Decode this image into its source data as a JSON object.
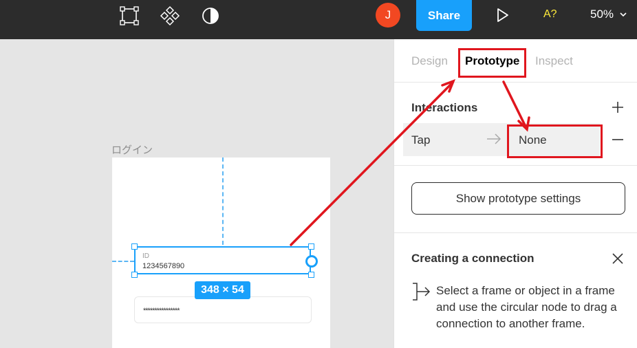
{
  "toolbar": {
    "icons": [
      "frame-tool-icon",
      "component-icon",
      "contrast-icon"
    ],
    "avatar_initial": "J",
    "share_label": "Share",
    "play_icon": "play-icon",
    "accessibility_label": "A?",
    "zoom_label": "50%"
  },
  "canvas": {
    "frame_label": "ログイン",
    "id_field": {
      "label": "ID",
      "value": "1234567890"
    },
    "size_badge": "348 × 54",
    "password_field": {
      "value": "****************"
    }
  },
  "panel": {
    "tabs": [
      "Design",
      "Prototype",
      "Inspect"
    ],
    "active_tab": "Prototype",
    "interactions": {
      "title": "Interactions",
      "trigger": "Tap",
      "action": "None"
    },
    "settings_button": "Show prototype settings",
    "connection": {
      "title": "Creating a connection",
      "help": "Select a frame or object in a frame and use the circular node to drag a connection to another frame."
    }
  },
  "colors": {
    "toolbar_bg": "#2c2c2c",
    "accent": "#18a0fb",
    "annotation_red": "#e0161e",
    "avatar": "#f24822"
  }
}
